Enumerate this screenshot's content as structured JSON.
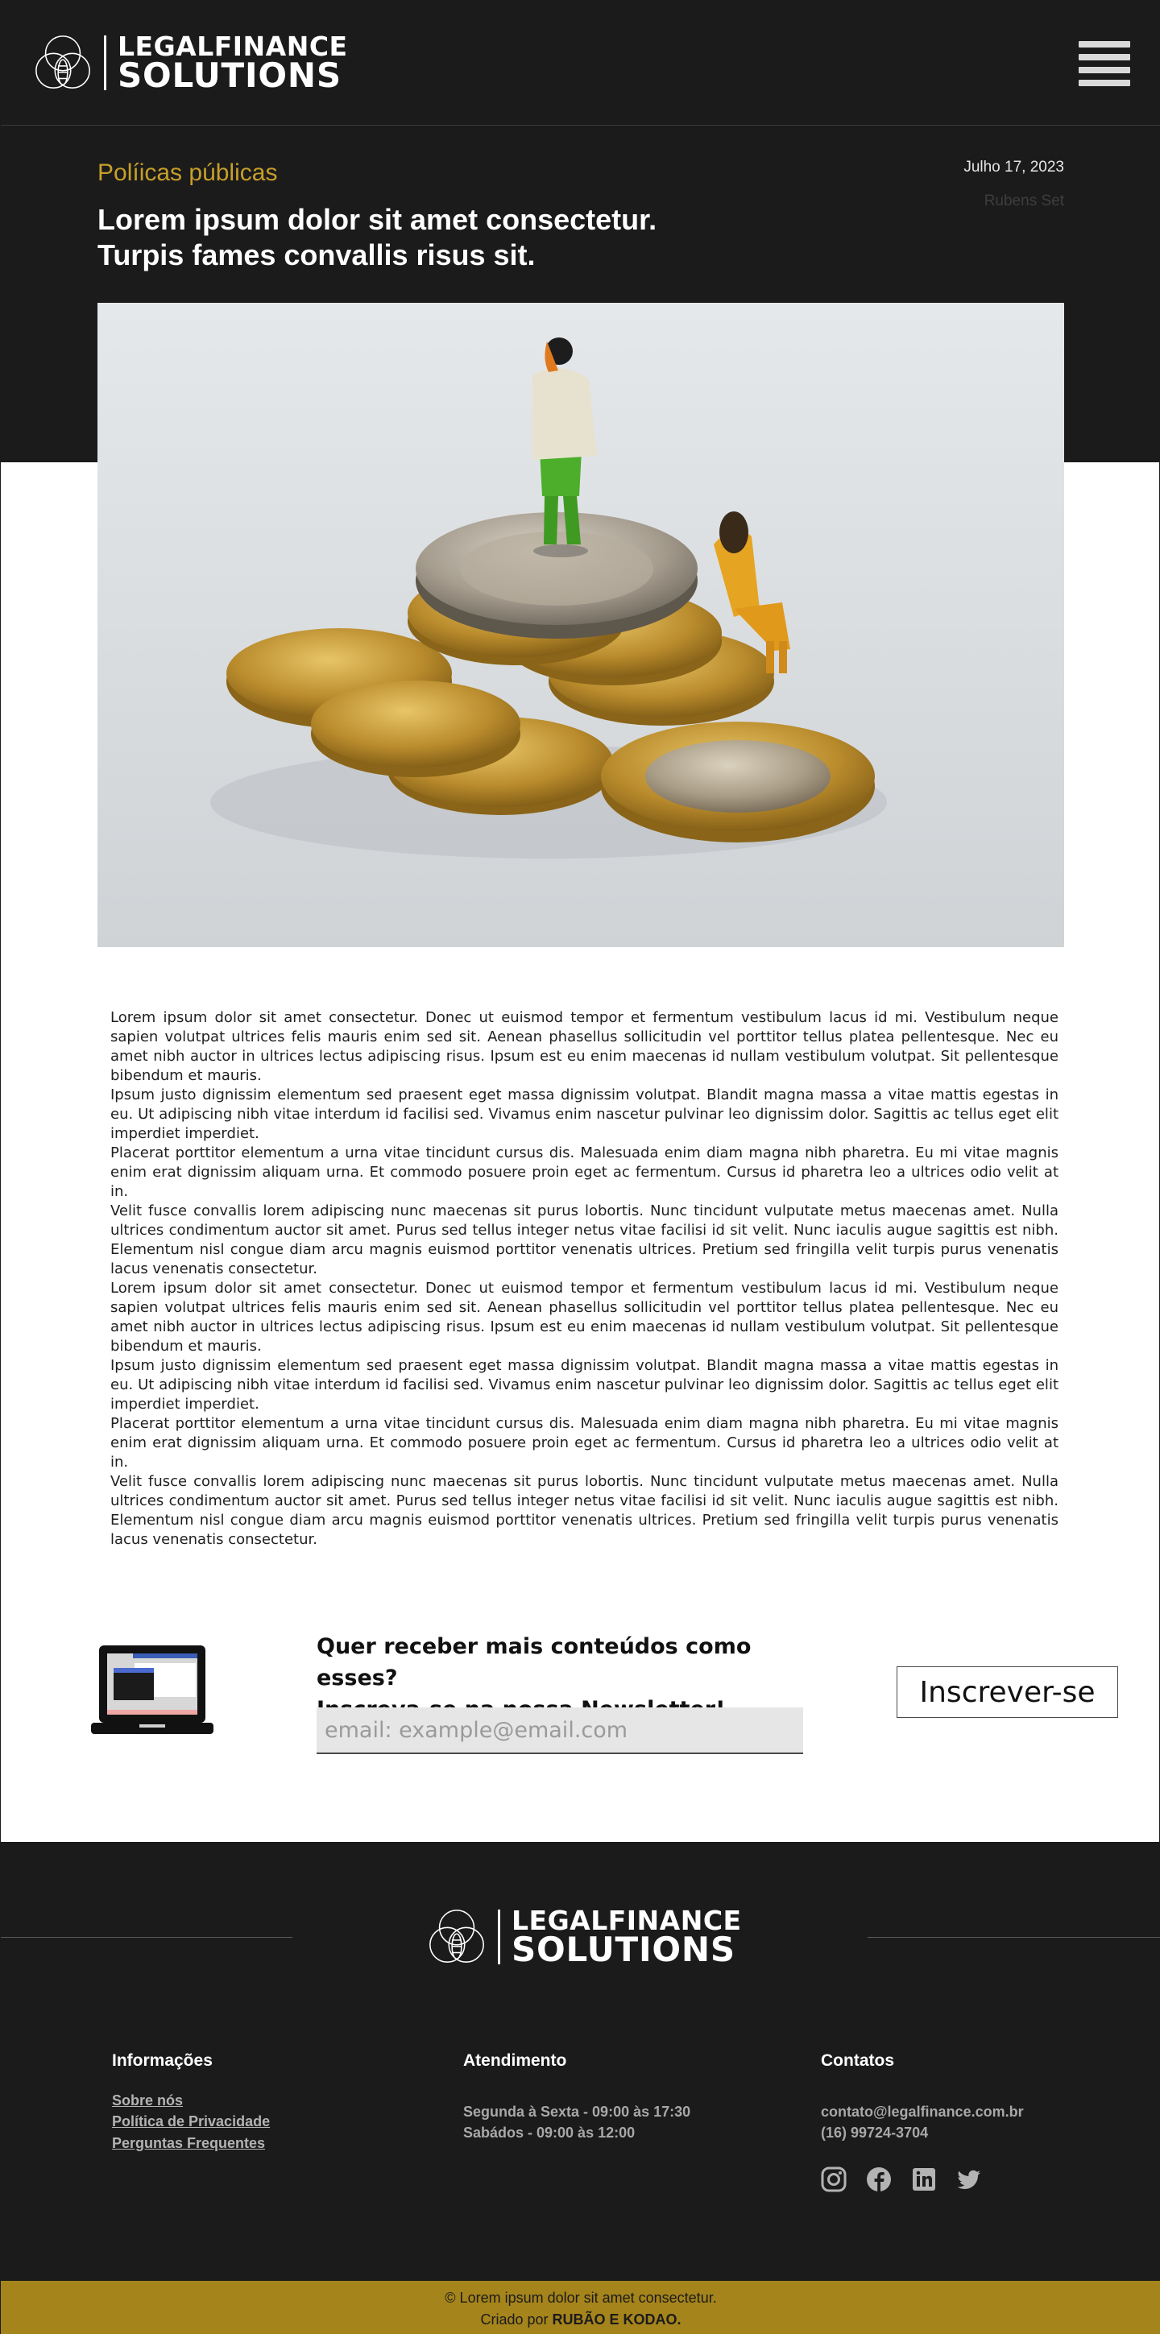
{
  "brand": {
    "line1": "LEGALFINANCE",
    "line2": "SOLUTIONS"
  },
  "article": {
    "category": "Políicas públicas",
    "title_line1": "Lorem ipsum dolor sit amet consectetur.",
    "title_line2": "Turpis fames convallis risus sit.",
    "date": "Julho 17, 2023",
    "author": "Rubens Set",
    "paragraphs": [
      "Lorem ipsum dolor sit amet consectetur. Donec ut euismod tempor et fermentum vestibulum lacus id mi. Vestibulum neque sapien volutpat ultrices felis mauris enim sed sit. Aenean phasellus sollicitudin vel porttitor tellus platea pellentesque. Nec eu amet nibh auctor in ultrices lectus adipiscing risus. Ipsum est eu enim maecenas id nullam vestibulum volutpat. Sit pellentesque bibendum et mauris.",
      "Ipsum justo dignissim elementum sed praesent eget massa dignissim volutpat. Blandit magna massa a vitae mattis egestas in eu. Ut adipiscing nibh vitae interdum id facilisi sed. Vivamus enim nascetur pulvinar leo dignissim dolor. Sagittis ac tellus eget elit imperdiet imperdiet.",
      "Placerat porttitor elementum a urna vitae tincidunt cursus dis. Malesuada enim diam magna nibh pharetra. Eu mi vitae magnis enim erat dignissim aliquam urna. Et commodo posuere proin eget ac fermentum. Cursus id pharetra leo a ultrices odio velit at in.",
      "Velit fusce convallis lorem adipiscing nunc maecenas sit purus lobortis. Nunc tincidunt vulputate metus maecenas amet. Nulla ultrices condimentum auctor sit amet. Purus sed tellus integer netus vitae facilisi id sit velit. Nunc iaculis augue sagittis est nibh. Elementum nisl congue diam arcu magnis euismod porttitor venenatis ultrices. Pretium sed fringilla velit turpis purus venenatis lacus venenatis consectetur.",
      "Lorem ipsum dolor sit amet consectetur. Donec ut euismod tempor et fermentum vestibulum lacus id mi. Vestibulum neque sapien volutpat ultrices felis mauris enim sed sit. Aenean phasellus sollicitudin vel porttitor tellus platea pellentesque. Nec eu amet nibh auctor in ultrices lectus adipiscing risus. Ipsum est eu enim maecenas id nullam vestibulum volutpat. Sit pellentesque bibendum et mauris.",
      "Ipsum justo dignissim elementum sed praesent eget massa dignissim volutpat. Blandit magna massa a vitae mattis egestas in eu. Ut adipiscing nibh vitae interdum id facilisi sed. Vivamus enim nascetur pulvinar leo dignissim dolor. Sagittis ac tellus eget elit imperdiet imperdiet.",
      "Placerat porttitor elementum a urna vitae tincidunt cursus dis. Malesuada enim diam magna nibh pharetra. Eu mi vitae magnis enim erat dignissim aliquam urna. Et commodo posuere proin eget ac fermentum. Cursus id pharetra leo a ultrices odio velit at in.",
      "Velit fusce convallis lorem adipiscing nunc maecenas sit purus lobortis. Nunc tincidunt vulputate metus maecenas amet. Nulla ultrices condimentum auctor sit amet. Purus sed tellus integer netus vitae facilisi id sit velit. Nunc iaculis augue sagittis est nibh. Elementum nisl congue diam arcu magnis euismod porttitor venenatis ultrices. Pretium sed fringilla velit turpis purus venenatis lacus venenatis consectetur."
    ]
  },
  "newsletter": {
    "heading_line1": "Quer receber mais conteúdos como esses?",
    "heading_line2": "Inscreva-se na nossa Newsletter!",
    "email_placeholder": "email: example@email.com",
    "button_label": "Inscrever-se"
  },
  "footer": {
    "info": {
      "title": "Informações",
      "links": [
        "Sobre nós",
        "Política de Privacidade",
        "Perguntas Frequentes"
      ]
    },
    "service": {
      "title": "Atendimento",
      "lines": [
        "Segunda à Sexta - 09:00 às 17:30",
        "Sabádos - 09:00 às 12:00"
      ]
    },
    "contact": {
      "title": "Contatos",
      "email": "contato@legalfinance.com.br",
      "phone": "(16) 99724-3704"
    },
    "social": [
      "instagram-icon",
      "facebook-icon",
      "linkedin-icon",
      "twitter-icon"
    ],
    "copyright": "© Lorem ipsum dolor sit amet consectetur.",
    "credit_prefix": "Criado por ",
    "credit_names": "RUBÃO E KODAO."
  },
  "colors": {
    "dark": "#1b1b1b",
    "accent": "#c79f2a",
    "bottom_bar": "#a5841b"
  }
}
